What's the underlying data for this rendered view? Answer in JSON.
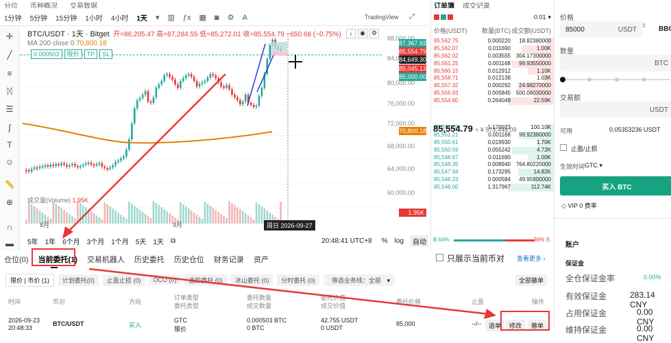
{
  "topbar": {
    "items": [
      "分位",
      "币种概况",
      "交易数据"
    ]
  },
  "timeframes": {
    "items": [
      "1分钟",
      "5分钟",
      "15分钟",
      "1小时",
      "4小时",
      "1天"
    ],
    "selected": "1天"
  },
  "tradingview_label": "TradingView",
  "chart": {
    "symbol": "BTC/USDT · 1天 · Bitget",
    "open_label": "开=86,205.47",
    "high_label": "高=87,284.55",
    "low_label": "低=85,272.01",
    "close_label": "收=85,554.79",
    "change_label": "−650.68 (−0.75%)",
    "ma_label": "MA 200 close 0",
    "ma_value": "70,800.18",
    "order_qty": "0.000503",
    "order_type": "限价",
    "tp": "TP",
    "sl": "SL",
    "volume_label": "成交量(Volume)",
    "volume_value": "1.95K",
    "y_ticks": [
      "88,000.00",
      "84,000.00",
      "80,000.00",
      "76,000.00",
      "72,000.00",
      "68,000.00",
      "64,000.00",
      "60,000.00"
    ],
    "price_tags": [
      {
        "text": "87,367.92",
        "color": "#26a69a"
      },
      {
        "text": "85,554.79",
        "color": "#e53935"
      },
      {
        "text": "84,649.30",
        "color": "#222"
      },
      {
        "text": "85,045.13",
        "color": "#e53935"
      },
      {
        "text": "85,000.00",
        "color": "#26a69a"
      },
      {
        "text": "70,800.18",
        "color": "#e67e00"
      },
      {
        "text": "1.95K",
        "color": "#e53935"
      }
    ],
    "x_labels": [
      "8月",
      "9月"
    ],
    "date_label": "周日 2026-09-27"
  },
  "range": {
    "items": [
      "5年",
      "1年",
      "6个月",
      "3个月",
      "1个月",
      "5天",
      "1天"
    ],
    "clock": "20:48:41 UTC+8",
    "pct": "%",
    "log": "log",
    "auto": "自动"
  },
  "orderbook": {
    "tabs": [
      "订单簿",
      "成交记录"
    ],
    "headers": [
      "价格(USDT)",
      "数量(BTC)",
      "成交额(USDT)"
    ],
    "tick": "0.01",
    "asks": [
      [
        "85,562.75",
        "0.000220",
        "18.82380000"
      ],
      [
        "85,562.07",
        "0.011690",
        "1.00K"
      ],
      [
        "85,562.02",
        "0.003555",
        "304.17300000"
      ],
      [
        "85,561.25",
        "0.001168",
        "99.93550000"
      ],
      [
        "85,560.15",
        "0.012912",
        "1.10K"
      ],
      [
        "85,558.71",
        "0.012138",
        "1.03K"
      ],
      [
        "85,557.32",
        "0.000292",
        "24.98270000"
      ],
      [
        "85,556.93",
        "0.005845",
        "500.08030000"
      ],
      [
        "85,554.80",
        "0.264049",
        "22.59K"
      ]
    ],
    "mid": "85,554.79",
    "mid_usd": "≈ ¥ 573,448.09",
    "bids": [
      [
        "85,554.79",
        "1.170023",
        "100.10K"
      ],
      [
        "85,551.21",
        "0.001168",
        "99.92380000"
      ],
      [
        "85,550.61",
        "0.019930",
        "1.70K"
      ],
      [
        "85,550.59",
        "0.055242",
        "4.72K"
      ],
      [
        "85,548.67",
        "0.011690",
        "1.00K"
      ],
      [
        "85,548.35",
        "0.008940",
        "764.80220000"
      ],
      [
        "85,547.94",
        "0.173295",
        "14.82K"
      ],
      [
        "85,546.23",
        "0.000584",
        "49.95900000"
      ],
      [
        "85,546.00",
        "1.317967",
        "112.74K"
      ]
    ],
    "buy_pct": "B 64%",
    "sell_pct": "36% S"
  },
  "form": {
    "price_label": "价格",
    "price_value": "85000",
    "price_unit": "USDT",
    "alt_unit": "BBO",
    "qty_label": "数量",
    "qty_unit": "BTC",
    "amount_label": "交易额",
    "amount_unit": "USDT",
    "available_label": "可用",
    "available_value": "0.05353236 USDT",
    "tpsl_label": "止盈/止损",
    "tif_label": "生效时间",
    "tif_value": "GTC",
    "buy_label": "买入 BTC",
    "vip_label": "VIP 0 费率",
    "account_title": "账户",
    "margin_title": "保证金",
    "rows": [
      {
        "label": "全仓保证金率",
        "value": "0.00%"
      },
      {
        "label": "有效保证金",
        "value": "283.14 CNY"
      },
      {
        "label": "占用保证金",
        "value": "0.00 CNY"
      },
      {
        "label": "维持保证金",
        "value": "0.00 CNY"
      }
    ]
  },
  "bottom": {
    "tabs": [
      "仓位(0)",
      "当前委托(1)",
      "交易机器人",
      "历史委托",
      "历史仓位",
      "财务记录",
      "资产"
    ],
    "only_current": "只展示当前币对",
    "more": "查看更多 ›",
    "subtabs": [
      "限价 | 市价 (1)",
      "计划委托(0)",
      "止盈止损 (0)",
      "OCO (0)",
      "追踪委托 (0)",
      "冰山委托 (0)",
      "分时委托 (0)"
    ],
    "filter": "筛选业务线：全部",
    "cancel_all": "全部撤单",
    "headers": [
      "时间",
      "币对",
      "方向",
      "订单类型",
      "委托数量",
      "委托价值",
      "委托价格",
      "止盈",
      "操作"
    ],
    "headers2": [
      "",
      "",
      "",
      "委托类型",
      "成交数量",
      "成交价值",
      "",
      "",
      ""
    ],
    "row": {
      "time": "2026-09-23",
      "time2": "20:48:33",
      "pair": "BTC/USDT",
      "side": "买入",
      "type": "GTC",
      "type2": "限价",
      "qty": "0.000503 BTC",
      "qty2": "0 BTC",
      "value": "42.755 USDT",
      "value2": "0 USDT",
      "price": "85,000",
      "tp": "--/--",
      "a1": "追单",
      "a2": "修改",
      "a3": "撤单"
    }
  }
}
